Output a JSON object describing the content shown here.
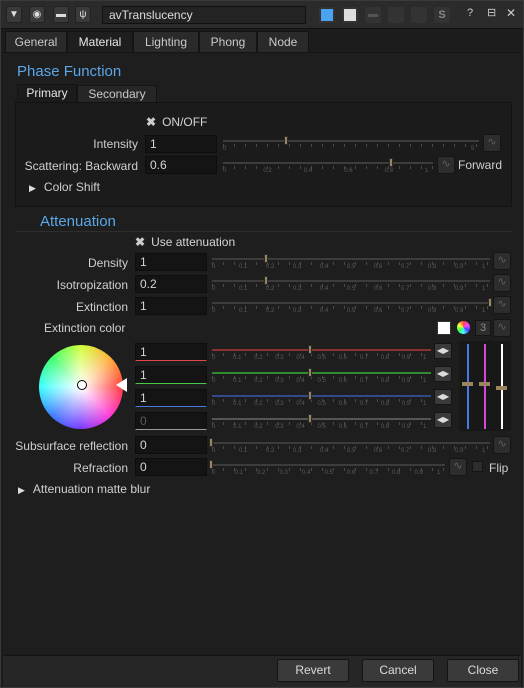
{
  "title": {
    "name": "avTranslucency"
  },
  "tabs": [
    "General",
    "Material",
    "Lighting",
    "Phong",
    "Node"
  ],
  "phase": {
    "title": "Phase Function",
    "subtabs": [
      "Primary",
      "Secondary"
    ],
    "onoff": "ON/OFF",
    "intensity_label": "Intensity",
    "intensity_value": "1",
    "intensity_ticks": [
      "0",
      "",
      "",
      "",
      "",
      "5"
    ],
    "scatter_label": "Scattering: Backward",
    "scatter_value": "0.6",
    "scatter_ticks": [
      "0",
      "0.2",
      "0.4",
      "0.6",
      "0.8",
      "1"
    ],
    "forward_label": "Forward",
    "color_shift": "Color Shift"
  },
  "atten": {
    "title": "Attenuation",
    "use": "Use attenuation",
    "density_label": "Density",
    "density_value": "1",
    "iso_label": "Isotropization",
    "iso_value": "0.2",
    "ext_label": "Extinction",
    "ext_value": "1",
    "extcolor_label": "Extinction color",
    "extcolor_count": "3",
    "rgba": [
      "1",
      "1",
      "1",
      "0"
    ],
    "subsurface_label": "Subsurface reflection",
    "subsurface_value": "0",
    "refraction_label": "Refraction",
    "refraction_value": "0",
    "flip_label": "Flip",
    "matte_blur": "Attenuation matte blur",
    "tick_nums": [
      "0",
      "0.1",
      "0.2",
      "0.3",
      "0.4",
      "0.5",
      "0.6",
      "0.7",
      "0.8",
      "0.9",
      "1"
    ]
  },
  "footer": {
    "revert": "Revert",
    "cancel": "Cancel",
    "close": "Close"
  },
  "colors": {
    "accent": "#5ba7e8",
    "red": "#e04848",
    "green": "#48c848",
    "blue": "#4878e0",
    "magenta": "#d848d8"
  }
}
